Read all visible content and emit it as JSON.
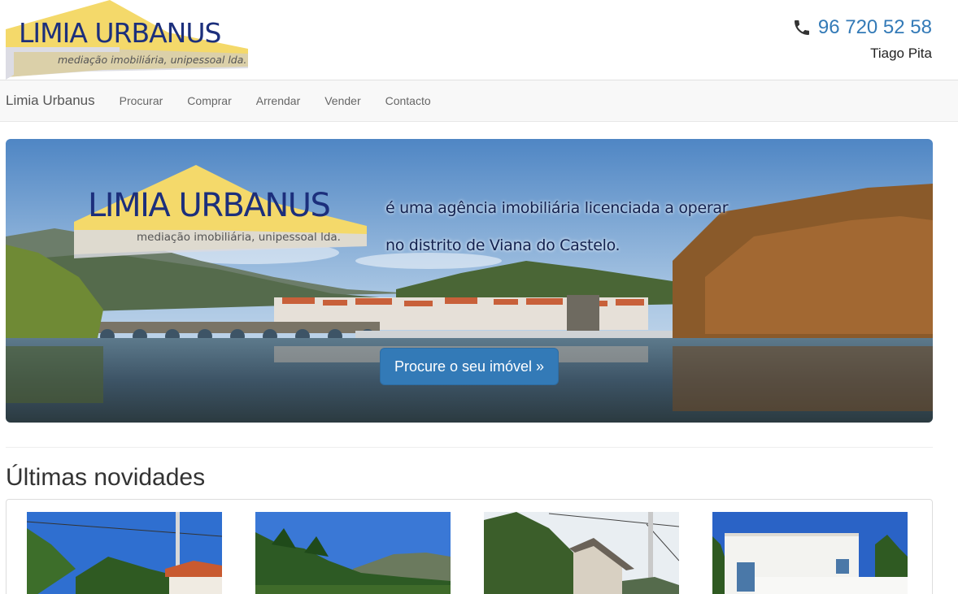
{
  "header": {
    "logo_title": "LIMIA URBANUS",
    "logo_subtitle": "mediação imobiliária, unipessoal lda.",
    "phone_icon": "phone-icon",
    "phone": "96 720 52 58",
    "agent_name": "Tiago Pita"
  },
  "navbar": {
    "brand": "Limia Urbanus",
    "items": [
      {
        "label": "Procurar"
      },
      {
        "label": "Comprar"
      },
      {
        "label": "Arrendar"
      },
      {
        "label": "Vender"
      },
      {
        "label": "Contacto"
      }
    ]
  },
  "hero": {
    "logo_title": "LIMIA URBANUS",
    "logo_subtitle": "mediação imobiliária, unipessoal lda.",
    "tagline_line1": "é uma agência imobiliária licenciada a operar",
    "tagline_line2": "no distrito de Viana do Castelo.",
    "cta_label": "Procure o seu imóvel »"
  },
  "latest": {
    "title": "Últimas novidades",
    "listings": [
      {
        "image": "house-photo-1"
      },
      {
        "image": "land-photo-2"
      },
      {
        "image": "house-photo-3"
      },
      {
        "image": "house-photo-4"
      }
    ]
  },
  "colors": {
    "accent": "#337ab7",
    "logo_blue": "#1c2f7c",
    "logo_yellow": "#f4d96a",
    "navbar_bg": "#f8f8f8"
  }
}
